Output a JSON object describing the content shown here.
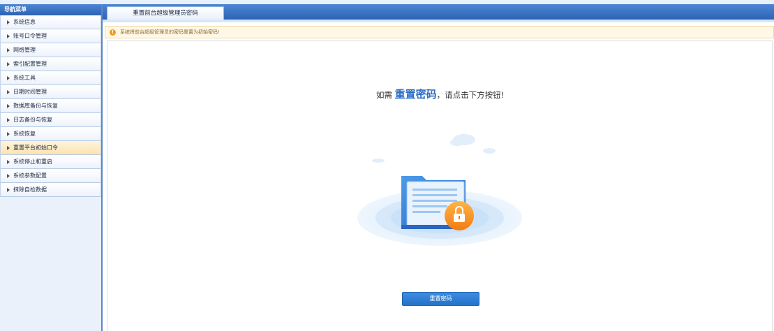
{
  "sidebar": {
    "title": "导航菜单",
    "items": [
      {
        "label": "系统信息"
      },
      {
        "label": "账号口令管理"
      },
      {
        "label": "网络管理"
      },
      {
        "label": "索引配置管理"
      },
      {
        "label": "系统工具"
      },
      {
        "label": "日期时间管理"
      },
      {
        "label": "数据库备份与恢复"
      },
      {
        "label": "日志备份与恢复"
      },
      {
        "label": "系统恢复"
      },
      {
        "label": "重置平台初始口令",
        "active": true
      },
      {
        "label": "系统停止和重启"
      },
      {
        "label": "系统参数配置"
      },
      {
        "label": "抹除自检数据"
      }
    ]
  },
  "tab": {
    "label": "重置前台超级管理员密码"
  },
  "notice": {
    "text": "系统将前台超级管理员的密码重置为初始密码!"
  },
  "main": {
    "prompt_prefix": "如需",
    "prompt_highlight": "重置密码",
    "prompt_suffix": "，请点击下方按钮!",
    "button_label": "重置密码"
  },
  "colors": {
    "accent": "#2d63b3",
    "active_item": "#fde3ae",
    "notice_icon": "#f39b1c",
    "button": "#2572c9"
  }
}
